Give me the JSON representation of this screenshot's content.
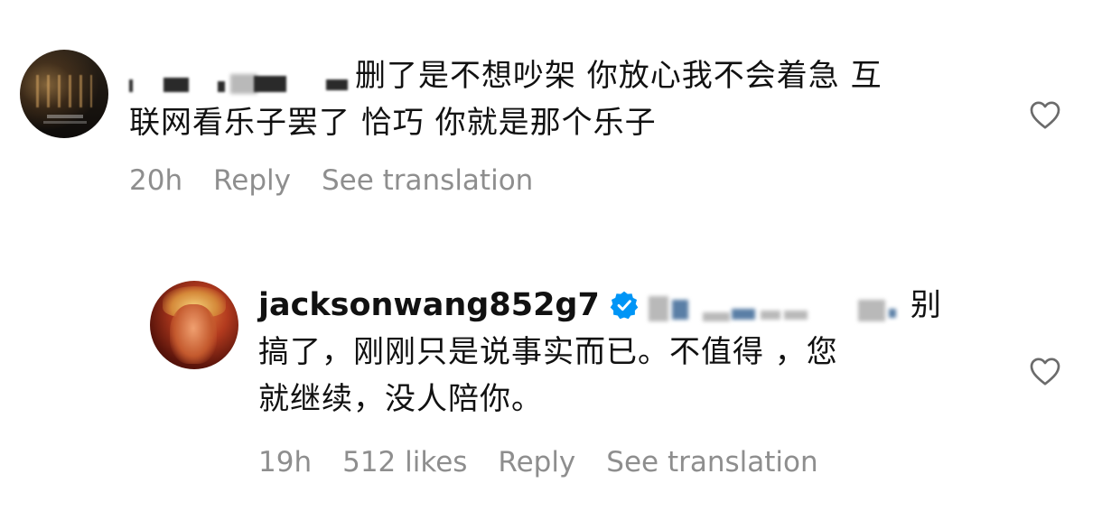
{
  "comments": [
    {
      "avatar": "dark-scene-avatar",
      "username": "",
      "text_line1": "删了是不想吵架 你放心我不会着急 互",
      "text_line2": "联网看乐子罢了 恰巧 你就是那个乐子",
      "time": "20h",
      "likes": "",
      "reply_label": "Reply",
      "translate_label": "See translation",
      "like_icon": "heart-outline-icon"
    },
    {
      "avatar": "red-portrait-avatar",
      "username": "jacksonwang852g7",
      "verified_icon": "verified-badge-icon",
      "text_line1_tail": "别",
      "text_line2": "搞了，刚刚只是说事实而已。不值得 ，您",
      "text_line3": "就继续，没人陪你。",
      "time": "19h",
      "likes": "512 likes",
      "reply_label": "Reply",
      "translate_label": "See translation",
      "like_icon": "heart-outline-icon"
    }
  ],
  "colors": {
    "text": "#111111",
    "meta": "#8e8e8e",
    "verified": "#0095f6"
  }
}
